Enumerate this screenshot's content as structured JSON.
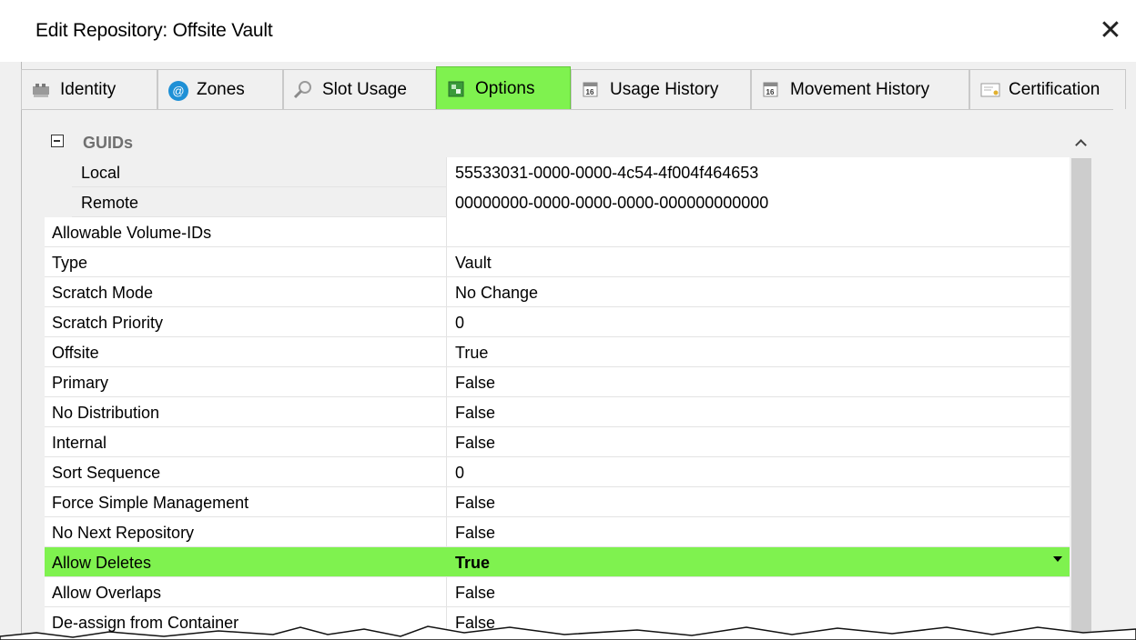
{
  "window": {
    "title": "Edit Repository: Offsite Vault",
    "close_label": "✕"
  },
  "tabs": [
    {
      "label": "Identity",
      "icon": "identity-icon",
      "active": false
    },
    {
      "label": "Zones",
      "icon": "zones-icon",
      "active": false
    },
    {
      "label": "Slot Usage",
      "icon": "magnifier-icon",
      "active": false
    },
    {
      "label": "Options",
      "icon": "options-icon",
      "active": true
    },
    {
      "label": "Usage History",
      "icon": "calendar-icon",
      "active": false
    },
    {
      "label": "Movement History",
      "icon": "calendar-icon",
      "active": false
    },
    {
      "label": "Certification",
      "icon": "certificate-icon",
      "active": false
    }
  ],
  "grid": {
    "category": {
      "label": "GUIDs",
      "expanded": true
    },
    "guid_rows": [
      {
        "label": "Local",
        "value": "55533031-0000-0000-4c54-4f004f464653"
      },
      {
        "label": "Remote",
        "value": "00000000-0000-0000-0000-000000000000"
      }
    ],
    "rows": [
      {
        "label": "Allowable Volume-IDs",
        "value": ""
      },
      {
        "label": "Type",
        "value": "Vault"
      },
      {
        "label": "Scratch Mode",
        "value": "No Change"
      },
      {
        "label": "Scratch Priority",
        "value": "0"
      },
      {
        "label": "Offsite",
        "value": "True"
      },
      {
        "label": "Primary",
        "value": "False"
      },
      {
        "label": "No Distribution",
        "value": "False"
      },
      {
        "label": "Internal",
        "value": "False"
      },
      {
        "label": "Sort Sequence",
        "value": "0"
      },
      {
        "label": "Force Simple Management",
        "value": "False"
      },
      {
        "label": "No Next Repository",
        "value": "False"
      },
      {
        "label": "Allow Deletes",
        "value": "True",
        "selected": true
      },
      {
        "label": "Allow Overlaps",
        "value": "False"
      },
      {
        "label": "De-assign from Container",
        "value": "False"
      }
    ]
  },
  "colors": {
    "highlight": "#7ff24f",
    "zones_icon": "#1e90d6",
    "category_text": "#707070"
  }
}
